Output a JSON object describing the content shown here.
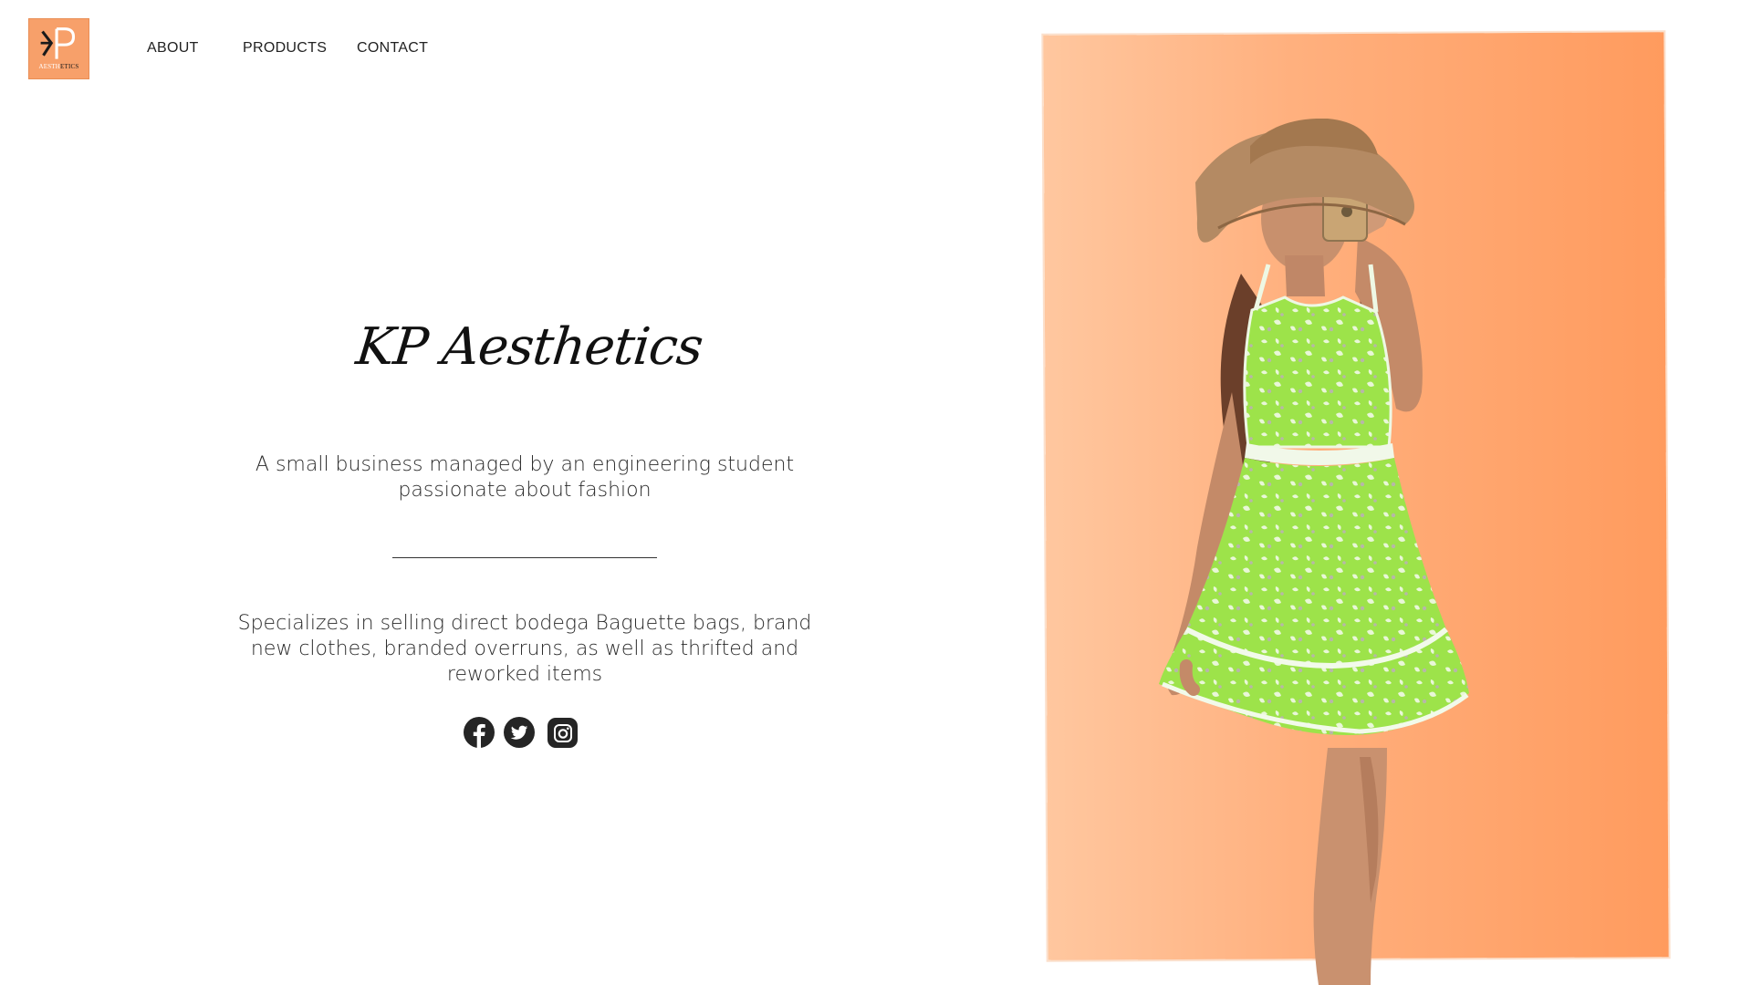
{
  "header": {
    "logo": {
      "monogram": "KP",
      "tag_light": "AESTH",
      "tag_dark": "ETICS",
      "background": "#f7a06a"
    },
    "nav": [
      {
        "label": "ABOUT"
      },
      {
        "label": "PRODUCTS"
      },
      {
        "label": "CONTACT"
      }
    ]
  },
  "hero": {
    "title": "KP Aesthetics",
    "tagline": "A small business managed by an engineering student passionate about fashion",
    "description": "Specializes in selling direct bodega Baguette bags, brand new clothes, branded overruns, as well as thrifted and reworked items",
    "social": [
      {
        "icon": "facebook-icon"
      },
      {
        "icon": "twitter-icon"
      },
      {
        "icon": "instagram-icon"
      }
    ]
  },
  "photo": {
    "subject": "woman-in-green-floral-dress-and-sun-hat",
    "background_colors": [
      "#ffc79f",
      "#ff9b5e"
    ]
  }
}
